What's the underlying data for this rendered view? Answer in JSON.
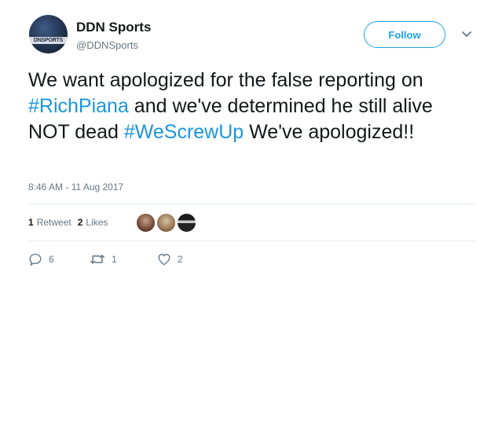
{
  "author": {
    "display_name": "DDN Sports",
    "handle": "@DDNSports",
    "avatar_text": "DNSPORTS"
  },
  "follow_label": "Follow",
  "tweet": {
    "text_1": "We want apologized for the false reporting on ",
    "hashtag_1": "#RichPiana",
    "text_2": " and we've determined he still alive NOT dead ",
    "hashtag_2": "#WeScrewUp",
    "text_3": " We've apologized!!"
  },
  "timestamp": "8:46 AM - 11 Aug 2017",
  "stats": {
    "retweet_count": "1",
    "retweet_label": "Retweet",
    "like_count": "2",
    "like_label": "Likes"
  },
  "actions": {
    "reply_count": "6",
    "retweet_count": "1",
    "like_count": "2"
  },
  "colors": {
    "accent": "#1da1f2",
    "hashtag": "#1b95e0",
    "muted_text": "#657786",
    "divider": "#e6ecf0"
  },
  "icons": [
    "chevron-down-icon",
    "reply-icon",
    "retweet-icon",
    "heart-icon"
  ]
}
